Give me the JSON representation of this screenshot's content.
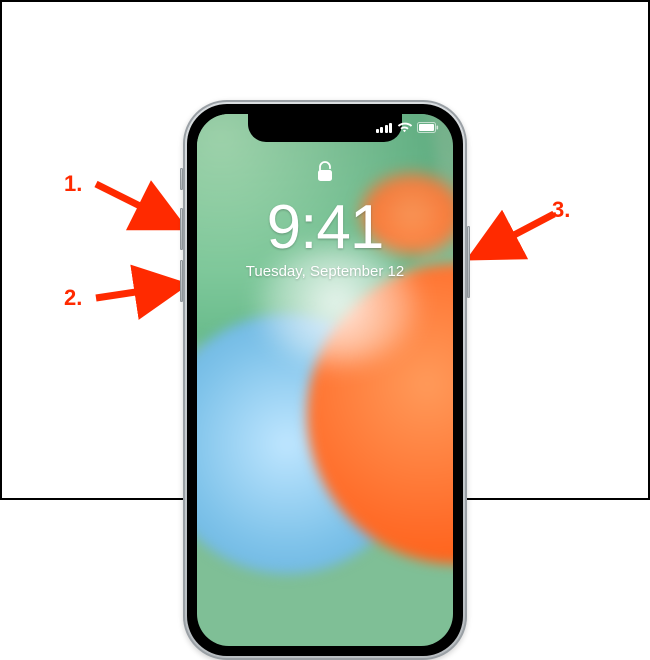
{
  "device": {
    "name": "iPhone X",
    "lock_time": "9:41",
    "lock_date": "Tuesday, September 12",
    "lock_state": "unlocked",
    "status": {
      "signal_bars": 4,
      "wifi": true,
      "battery_full": true
    }
  },
  "callouts": [
    {
      "id": "1",
      "label": "1.",
      "target": "volume-up-button",
      "side": "left"
    },
    {
      "id": "2",
      "label": "2.",
      "target": "volume-down-button",
      "side": "left"
    },
    {
      "id": "3",
      "label": "3.",
      "target": "side-button",
      "side": "right"
    }
  ],
  "colors": {
    "arrow": "#ff2a00",
    "wallpaper_green": "#7fbf96",
    "wallpaper_orange": "#ff6d2a",
    "wallpaper_blue": "#7fc3ea"
  }
}
